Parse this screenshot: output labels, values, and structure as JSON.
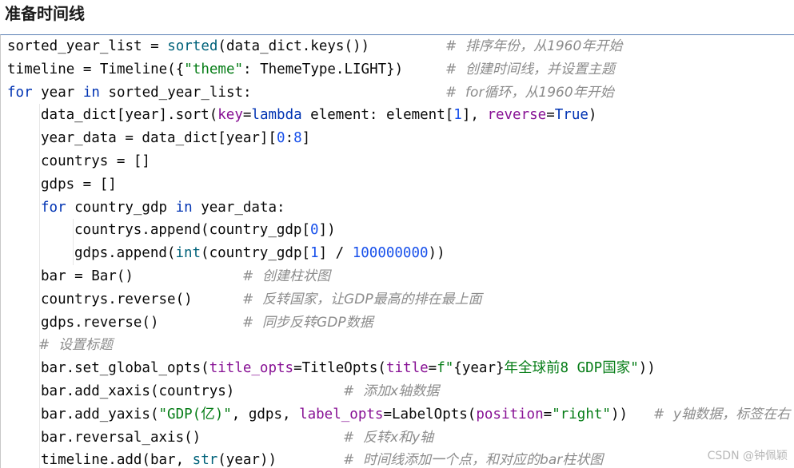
{
  "heading": "准备时间线",
  "watermark": "CSDN @钟佩颖",
  "code": [
    {
      "indent": 0,
      "tokens": [
        {
          "t": "sorted_year_list = ",
          "c": "plain"
        },
        {
          "t": "sorted",
          "c": "fn"
        },
        {
          "t": "(data_dict.keys())",
          "c": "plain"
        }
      ],
      "comment": "#  排序年份，从1960年开始"
    },
    {
      "indent": 0,
      "tokens": [
        {
          "t": "timeline = Timeline({",
          "c": "plain"
        },
        {
          "t": "\"theme\"",
          "c": "str"
        },
        {
          "t": ": ThemeType.LIGHT})",
          "c": "plain"
        }
      ],
      "comment": "#  创建时间线，并设置主题"
    },
    {
      "indent": 0,
      "tokens": [
        {
          "t": "for",
          "c": "kw"
        },
        {
          "t": " year ",
          "c": "plain"
        },
        {
          "t": "in",
          "c": "kw"
        },
        {
          "t": " sorted_year_list:",
          "c": "plain"
        }
      ],
      "comment": "#  for循环，从1960年开始"
    },
    {
      "indent": 1,
      "tokens": [
        {
          "t": "data_dict[year].sort(",
          "c": "plain"
        },
        {
          "t": "key",
          "c": "param"
        },
        {
          "t": "=",
          "c": "plain"
        },
        {
          "t": "lambda",
          "c": "kw"
        },
        {
          "t": " element: element[",
          "c": "plain"
        },
        {
          "t": "1",
          "c": "num"
        },
        {
          "t": "], ",
          "c": "plain"
        },
        {
          "t": "reverse",
          "c": "param"
        },
        {
          "t": "=",
          "c": "plain"
        },
        {
          "t": "True",
          "c": "kw"
        },
        {
          "t": ")",
          "c": "plain"
        }
      ],
      "comment": ""
    },
    {
      "indent": 1,
      "tokens": [
        {
          "t": "year_data = data_dict[year][",
          "c": "plain"
        },
        {
          "t": "0",
          "c": "num"
        },
        {
          "t": ":",
          "c": "plain"
        },
        {
          "t": "8",
          "c": "num"
        },
        {
          "t": "]",
          "c": "plain"
        }
      ],
      "comment": ""
    },
    {
      "indent": 1,
      "tokens": [
        {
          "t": "countrys = []",
          "c": "plain"
        }
      ],
      "comment": ""
    },
    {
      "indent": 1,
      "tokens": [
        {
          "t": "gdps = []",
          "c": "plain"
        }
      ],
      "comment": ""
    },
    {
      "indent": 1,
      "tokens": [
        {
          "t": "for",
          "c": "kw"
        },
        {
          "t": " country_gdp ",
          "c": "plain"
        },
        {
          "t": "in",
          "c": "kw"
        },
        {
          "t": " year_data:",
          "c": "plain"
        }
      ],
      "comment": ""
    },
    {
      "indent": 2,
      "tokens": [
        {
          "t": "countrys.append(country_gdp[",
          "c": "plain"
        },
        {
          "t": "0",
          "c": "num"
        },
        {
          "t": "])",
          "c": "plain"
        }
      ],
      "comment": ""
    },
    {
      "indent": 2,
      "tokens": [
        {
          "t": "gdps.append(",
          "c": "plain"
        },
        {
          "t": "int",
          "c": "fn"
        },
        {
          "t": "(country_gdp[",
          "c": "plain"
        },
        {
          "t": "1",
          "c": "num"
        },
        {
          "t": "] / ",
          "c": "plain"
        },
        {
          "t": "100000000",
          "c": "num"
        },
        {
          "t": "))",
          "c": "plain"
        }
      ],
      "comment": ""
    },
    {
      "indent": 1,
      "tokens": [
        {
          "t": "bar = Bar()",
          "c": "plain"
        }
      ],
      "comment": "#  创建柱状图"
    },
    {
      "indent": 1,
      "tokens": [
        {
          "t": "countrys.reverse()",
          "c": "plain"
        }
      ],
      "comment": "#  反转国家，让GDP最高的排在最上面"
    },
    {
      "indent": 1,
      "tokens": [
        {
          "t": "gdps.reverse()",
          "c": "plain"
        }
      ],
      "comment": "#  同步反转GDP数据"
    },
    {
      "indent": 1,
      "tokens": [],
      "comment": "#  设置标题"
    },
    {
      "indent": 1,
      "tokens": [
        {
          "t": "bar.set_global_opts(",
          "c": "plain"
        },
        {
          "t": "title_opts",
          "c": "param"
        },
        {
          "t": "=TitleOpts(",
          "c": "plain"
        },
        {
          "t": "title",
          "c": "param"
        },
        {
          "t": "=",
          "c": "plain"
        },
        {
          "t": "f\"",
          "c": "str"
        },
        {
          "t": "{year}",
          "c": "plain"
        },
        {
          "t": "年全球前8 GDP国家\"",
          "c": "str"
        },
        {
          "t": "))",
          "c": "plain"
        }
      ],
      "comment": ""
    },
    {
      "indent": 1,
      "tokens": [
        {
          "t": "bar.add_xaxis(countrys)",
          "c": "plain"
        }
      ],
      "comment": "#  添加x轴数据"
    },
    {
      "indent": 1,
      "tokens": [
        {
          "t": "bar.add_yaxis(",
          "c": "plain"
        },
        {
          "t": "\"GDP(亿)\"",
          "c": "str"
        },
        {
          "t": ", gdps, ",
          "c": "plain"
        },
        {
          "t": "label_opts",
          "c": "param"
        },
        {
          "t": "=LabelOpts(",
          "c": "plain"
        },
        {
          "t": "position",
          "c": "param"
        },
        {
          "t": "=",
          "c": "plain"
        },
        {
          "t": "\"right\"",
          "c": "str"
        },
        {
          "t": "))",
          "c": "plain"
        }
      ],
      "comment": "#  y轴数据，标签在右"
    },
    {
      "indent": 1,
      "tokens": [
        {
          "t": "bar.reversal_axis()",
          "c": "plain"
        }
      ],
      "comment": "#  反转x和y轴"
    },
    {
      "indent": 1,
      "tokens": [
        {
          "t": "timeline.add(bar, ",
          "c": "plain"
        },
        {
          "t": "str",
          "c": "fn"
        },
        {
          "t": "(year))",
          "c": "plain"
        }
      ],
      "comment": "#  时间线添加一个点，和对应的bar柱状图"
    }
  ]
}
